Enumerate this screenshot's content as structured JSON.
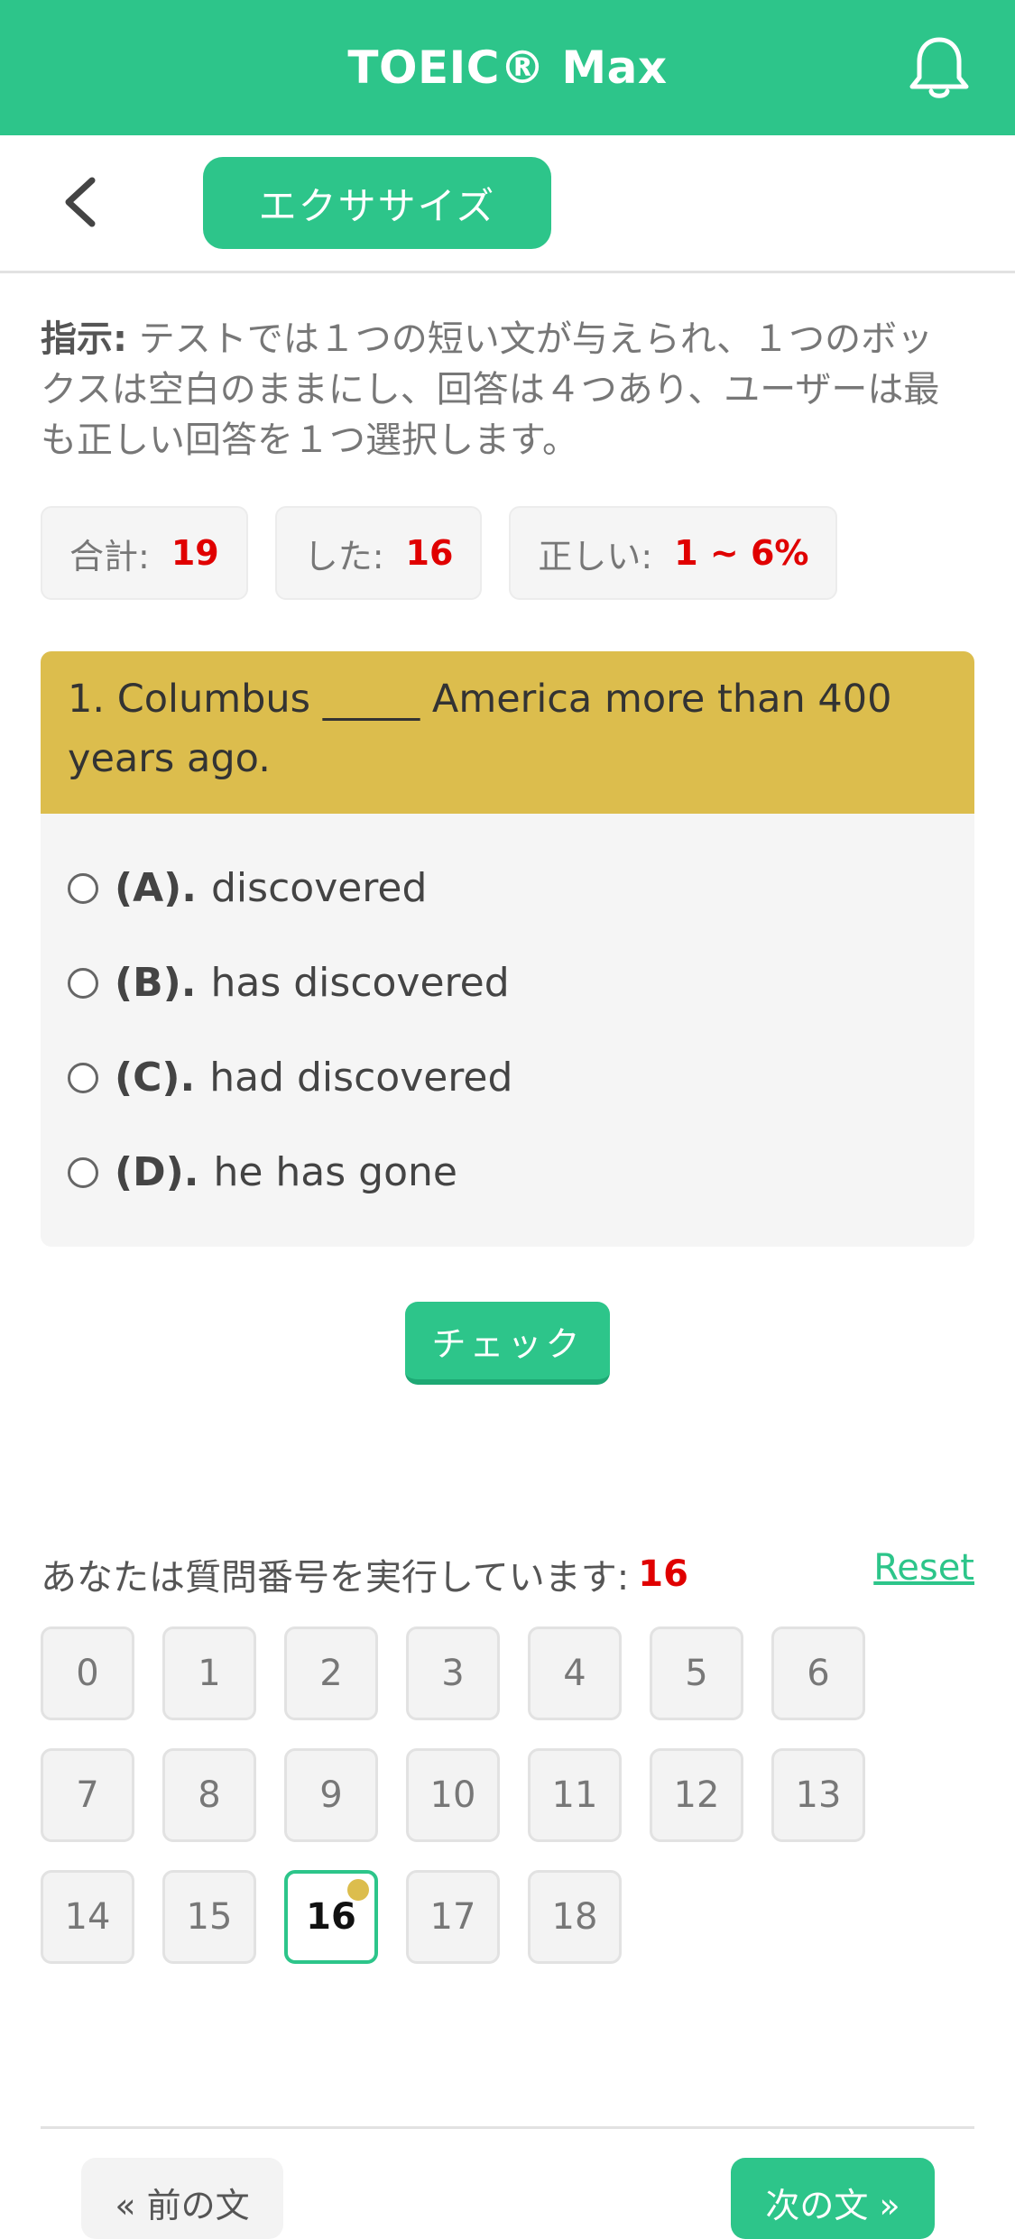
{
  "header": {
    "title": "TOEIC® Max"
  },
  "subbar": {
    "tab_label": "エクササイズ"
  },
  "instructions": {
    "label": "指示:",
    "text": " テストでは１つの短い文が与えられ、１つのボックスは空白のままにし、回答は４つあり、ユーザーは最も正しい回答を１つ選択します。"
  },
  "stats": {
    "total_label": "合計:",
    "total_value": "19",
    "done_label": "した:",
    "done_value": "16",
    "correct_label": "正しい:",
    "correct_value": "1 ~ 6%"
  },
  "question": {
    "text": "1. Columbus _____ America more than 400 years ago.",
    "options": [
      {
        "letter": "(A).",
        "text": "discovered"
      },
      {
        "letter": "(B).",
        "text": "has discovered"
      },
      {
        "letter": "(C).",
        "text": "had discovered"
      },
      {
        "letter": "(D).",
        "text": "he has gone"
      }
    ]
  },
  "check_button": "チェック",
  "progress": {
    "label": "あなたは質問番号を実行しています:",
    "current": "16",
    "reset": "Reset"
  },
  "numbers": [
    "0",
    "1",
    "2",
    "3",
    "4",
    "5",
    "6",
    "7",
    "8",
    "9",
    "10",
    "11",
    "12",
    "13",
    "14",
    "15",
    "16",
    "17",
    "18"
  ],
  "active_number": "16",
  "footer": {
    "prev": "« 前の文",
    "next": "次の文 »"
  },
  "colors": {
    "accent": "#2dc58a",
    "question_header": "#dcbd4d",
    "highlight": "#e00000"
  }
}
